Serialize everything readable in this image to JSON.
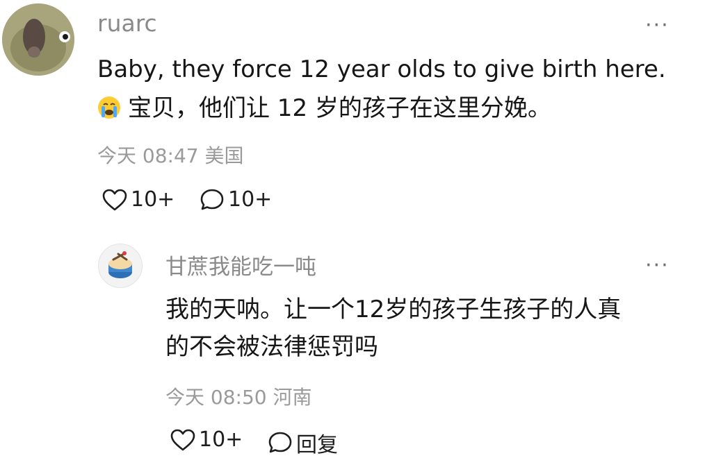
{
  "comment": {
    "username": "ruarc",
    "more_label": "···",
    "text_line1": "Baby, they force 12 year olds to give birth here.",
    "text_line2": "宝贝，他们让 12 岁的孩子在这里分娩。",
    "emoji_icon": "crying-face-icon",
    "time": "今天 08:47",
    "location": "美国",
    "likes": "10+",
    "replies": "10+"
  },
  "reply": {
    "username": "甘蔗我能吃一吨",
    "more_label": "···",
    "text_line1": "我的天呐。让一个12岁的孩子生孩子的人真",
    "text_line2": "的不会被法律惩罚吗",
    "time": "今天 08:50",
    "location": "河南",
    "likes": "10+",
    "reply_label": "回复"
  }
}
